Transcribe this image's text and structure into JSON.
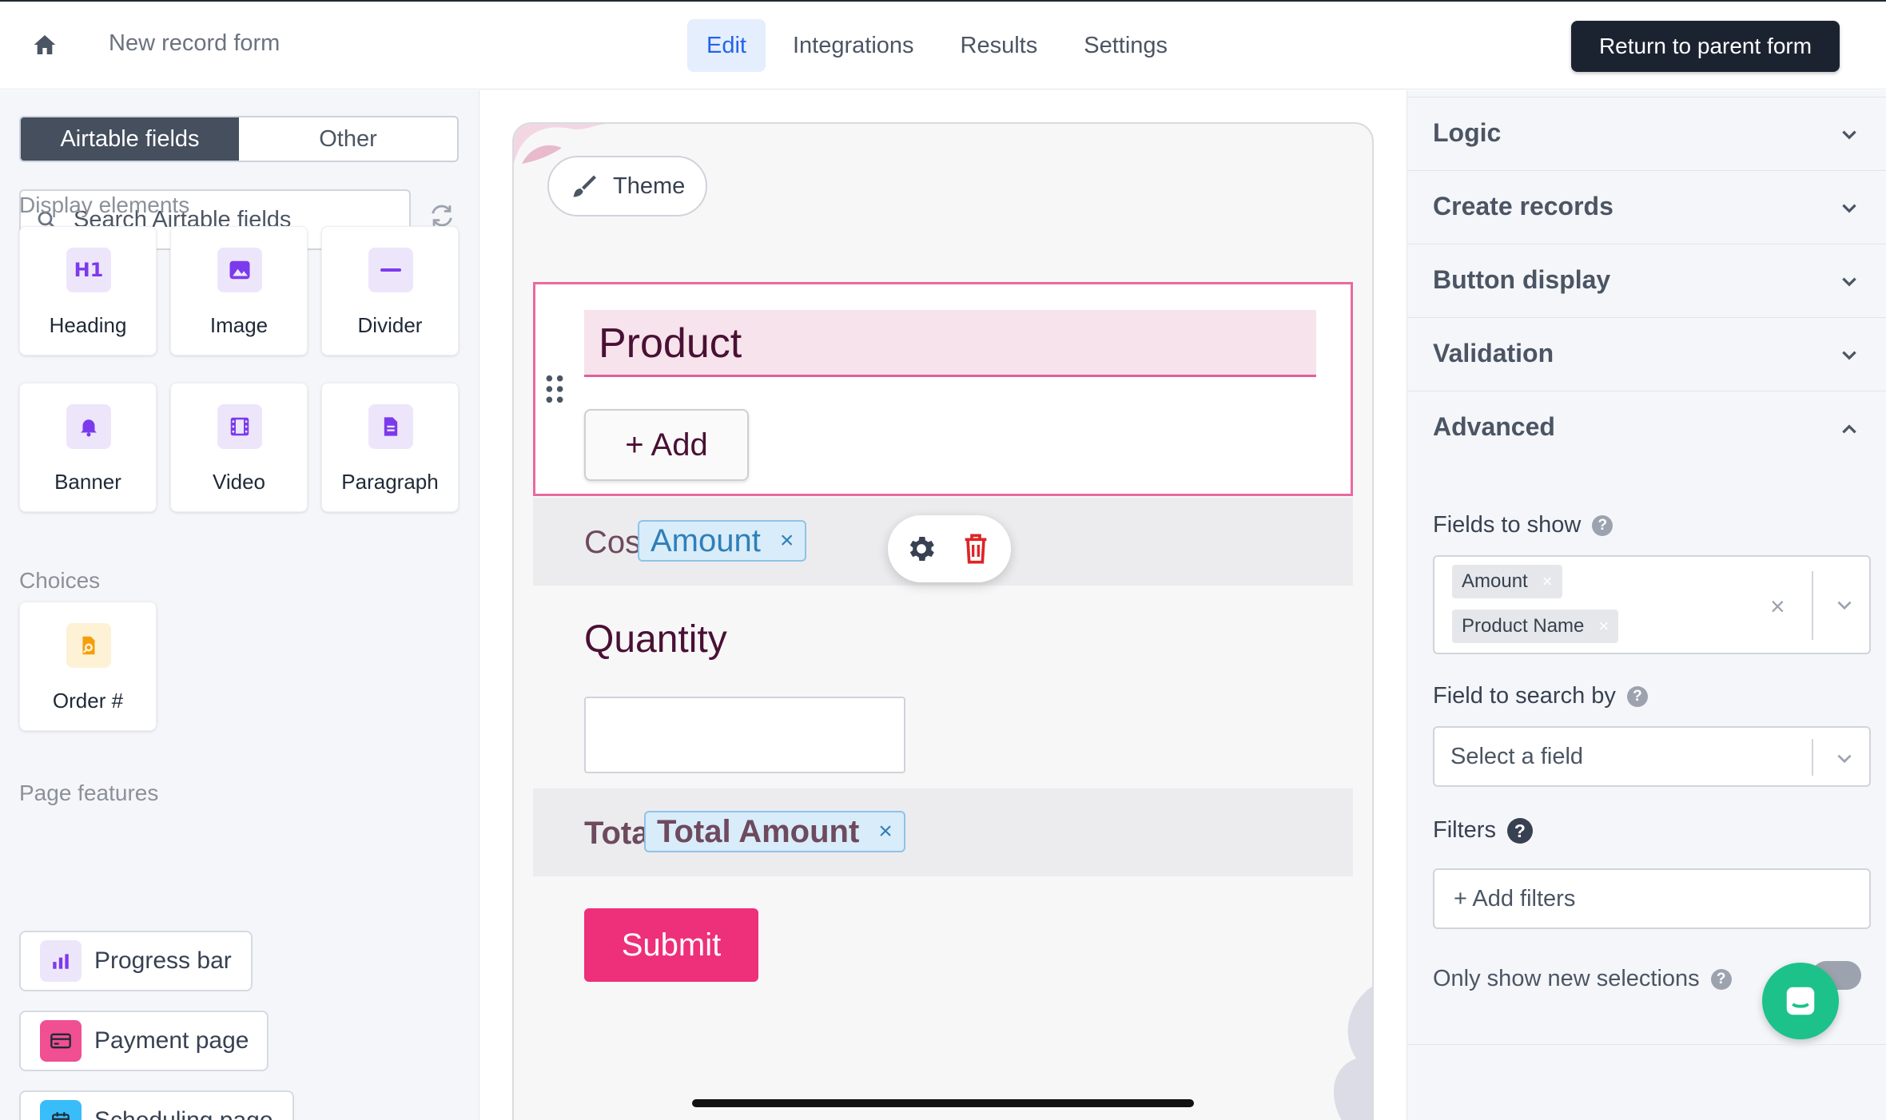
{
  "header": {
    "form_name": "New record form",
    "tabs": [
      {
        "label": "Edit",
        "active": true
      },
      {
        "label": "Integrations",
        "active": false
      },
      {
        "label": "Results",
        "active": false
      },
      {
        "label": "Settings",
        "active": false
      }
    ],
    "return_button": "Return to parent form"
  },
  "left": {
    "segments": [
      "Airtable fields",
      "Other"
    ],
    "search_placeholder": "Search Airtable fields",
    "display_label": "Display elements",
    "display_items": [
      {
        "label": "Heading",
        "icon": "heading-icon"
      },
      {
        "label": "Image",
        "icon": "image-icon"
      },
      {
        "label": "Divider",
        "icon": "divider-icon"
      },
      {
        "label": "Banner",
        "icon": "bell-icon"
      },
      {
        "label": "Video",
        "icon": "film-icon"
      },
      {
        "label": "Paragraph",
        "icon": "document-icon"
      }
    ],
    "choices_label": "Choices",
    "choice_items": [
      {
        "label": "Order #",
        "icon": "order-number-icon"
      }
    ],
    "page_features_label": "Page features",
    "features": [
      {
        "label": "Progress bar",
        "icon": "bar-chart-icon"
      },
      {
        "label": "Payment page",
        "icon": "credit-card-icon"
      },
      {
        "label": "Scheduling page",
        "icon": "calendar-icon"
      }
    ]
  },
  "form": {
    "theme_button": "Theme",
    "product_title": "Product",
    "add_button": "+ Add",
    "cost_label": "Cost: $",
    "cost_chip": "Amount",
    "quantity_label": "Quantity",
    "total_label": "Total: $",
    "total_chip": "Total Amount",
    "submit_button": "Submit"
  },
  "right": {
    "sections": [
      {
        "label": "Logic",
        "expanded": false
      },
      {
        "label": "Create records",
        "expanded": false
      },
      {
        "label": "Button display",
        "expanded": false
      },
      {
        "label": "Validation",
        "expanded": false
      },
      {
        "label": "Advanced",
        "expanded": true
      }
    ],
    "fields_to_show_label": "Fields to show",
    "fields_to_show": [
      "Amount",
      "Product Name"
    ],
    "field_to_search_label": "Field to search by",
    "field_to_search_placeholder": "Select a field",
    "filters_label": "Filters",
    "add_filters_button": "+ Add filters",
    "only_new_label": "Only show new selections"
  },
  "colors": {
    "accent_blue": "#2563eb",
    "brand_pink": "#ee2f7a",
    "selection_border": "#e86aa0",
    "dark_button": "#1c2330",
    "chat_green": "#1cc28a"
  }
}
